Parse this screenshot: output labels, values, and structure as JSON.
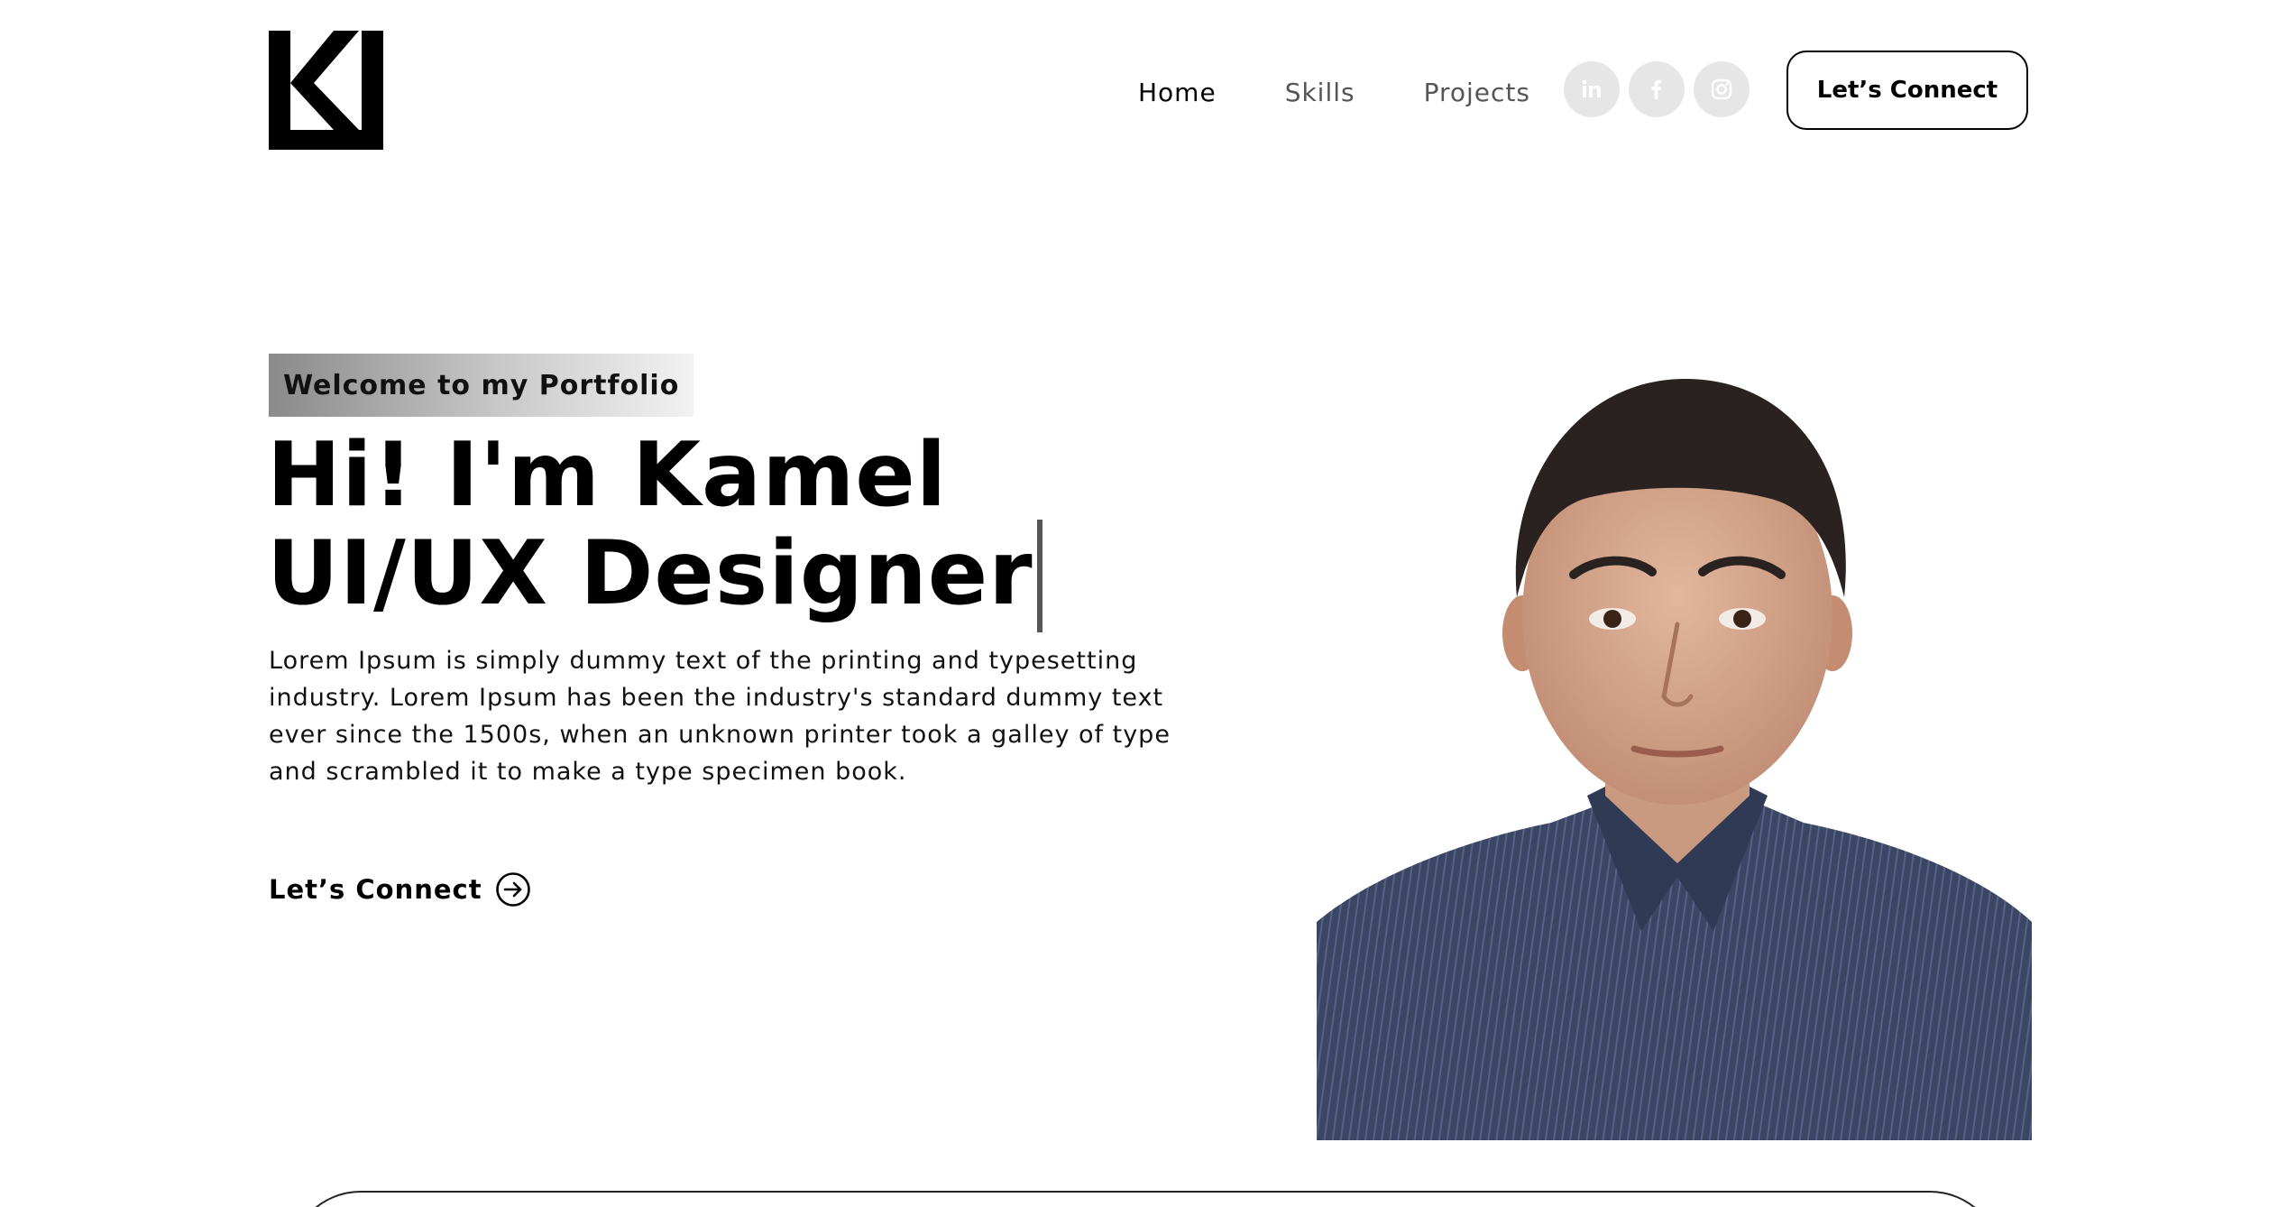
{
  "header": {
    "logo_icon": "kj-monogram-logo",
    "nav": [
      {
        "label": "Home",
        "active": true
      },
      {
        "label": "Skills",
        "active": false
      },
      {
        "label": "Projects",
        "active": false
      }
    ],
    "socials": [
      {
        "icon": "linkedin-icon"
      },
      {
        "icon": "facebook-icon"
      },
      {
        "icon": "instagram-icon"
      }
    ],
    "connect_label": "Let’s Connect"
  },
  "hero": {
    "tag": "Welcome to my Portfolio",
    "title": "Hi! I'm Kamel UI/UX Designer",
    "description": "Lorem Ipsum is simply dummy text of the printing and typesetting industry. Lorem Ipsum has been the industry's standard dummy text ever since the 1500s, when an unknown printer took a galley of type and scrambled it to make a type specimen book.",
    "cta_label": "Let’s Connect",
    "cta_icon": "arrow-right-circle-icon"
  },
  "portrait": {
    "description_icon": "profile-photo"
  },
  "colors": {
    "text": "#000000",
    "muted": "#555555",
    "social_bg": "#e6e6e6",
    "shirt": "#3b4663",
    "skin": "#d4a58a",
    "hair": "#2a2220"
  }
}
